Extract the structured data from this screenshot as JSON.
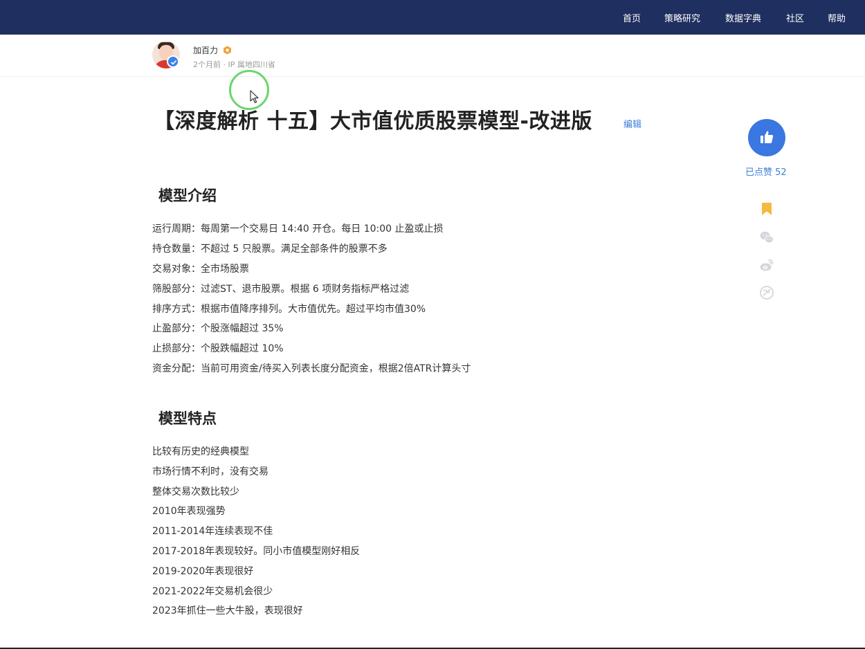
{
  "nav": {
    "items": [
      "首页",
      "策略研究",
      "数据字典",
      "社区",
      "帮助"
    ]
  },
  "author": {
    "name": "加百力",
    "meta": "2个月前 · IP 属地四川省"
  },
  "article": {
    "title": "【深度解析 十五】大市值优质股票模型-改进版",
    "edit_label": "编辑",
    "sections": [
      {
        "heading": "模型介绍",
        "lines": [
          "运行周期：每周第一个交易日 14:40 开仓。每日 10:00 止盈或止损",
          "持仓数量：不超过 5 只股票。满足全部条件的股票不多",
          "交易对象：全市场股票",
          "筛股部分：过滤ST、退市股票。根据 6 项财务指标严格过滤",
          "排序方式：根据市值降序排列。大市值优先。超过平均市值30%",
          "止盈部分：个股涨幅超过 35%",
          "止损部分：个股跌幅超过 10%",
          "资金分配：当前可用资金/待买入列表长度分配资金，根据2倍ATR计算头寸"
        ]
      },
      {
        "heading": "模型特点",
        "lines": [
          "比较有历史的经典模型",
          "市场行情不利时，没有交易",
          "整体交易次数比较少",
          "2010年表现强势",
          "2011-2014年连续表现不佳",
          "2017-2018年表现较好。同小市值模型刚好相反",
          "2019-2020年表现很好",
          "2021-2022年交易机会很少",
          "2023年抓住一些大牛股，表现很好"
        ]
      }
    ]
  },
  "sidebar": {
    "like_label": "已点赞 52",
    "icons": [
      "bookmark-icon",
      "wechat-icon",
      "weibo-icon",
      "qq-icon"
    ]
  },
  "colors": {
    "nav_bg": "#1f2f5f",
    "accent": "#3a77e0",
    "bookmark": "#f5b942",
    "cursor_ring": "#6bd66b"
  }
}
